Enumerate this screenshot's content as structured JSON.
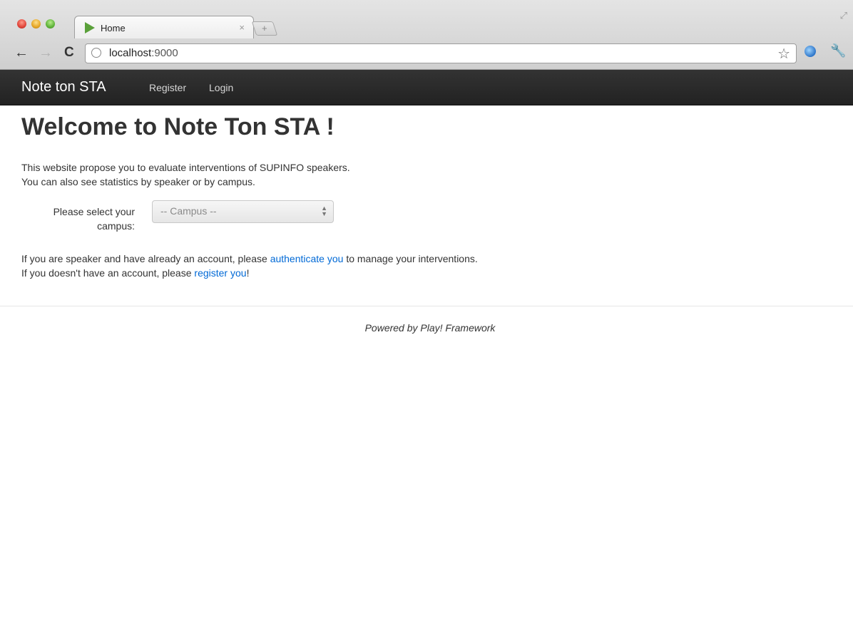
{
  "browser": {
    "tab_title": "Home",
    "tab_close": "×",
    "new_tab": "+",
    "url_host": "localhost",
    "url_port": ":9000"
  },
  "navbar": {
    "brand": "Note ton STA",
    "links": [
      "Register",
      "Login"
    ]
  },
  "main": {
    "title": "Welcome to Note Ton STA !",
    "intro": [
      "This website propose you to evaluate interventions of SUPINFO speakers.",
      "You can also see statistics by speaker or by campus."
    ],
    "campus_label": "Please select your campus:",
    "campus_select_value": "-- Campus --",
    "info_line1": {
      "before": "If you are speaker and have already an account, please ",
      "link": "authenticate you",
      "after": " to manage your interventions."
    },
    "info_line2": {
      "before": "If you doesn't have an account, please ",
      "link": "register you",
      "after": "!"
    }
  },
  "footer": {
    "text": "Powered by Play! Framework"
  },
  "colors": {
    "navbar_bg": "#222222",
    "link": "#0069d6",
    "text": "#333333"
  }
}
